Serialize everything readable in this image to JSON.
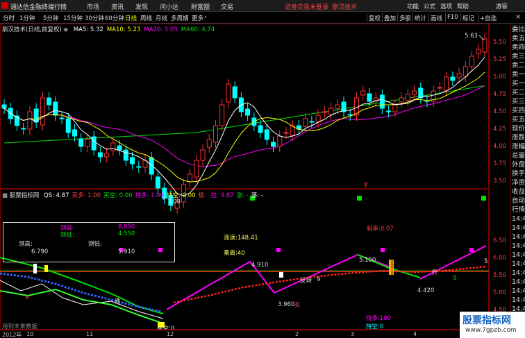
{
  "app": {
    "title": "通达信金融终端",
    "menus": [
      "行情",
      "市场",
      "资讯",
      "发现",
      "问小达",
      "财富圈",
      "交易"
    ],
    "notice": "证劵交易未登录",
    "stock_name_top": "鼎汉技术",
    "right_menus": [
      "功能",
      "公式",
      "选项",
      "帮助",
      "游客"
    ]
  },
  "toolbar": {
    "periods": [
      "分时",
      "1分钟",
      "5分钟",
      "15分钟",
      "30分钟",
      "60分钟",
      "日线",
      "周线",
      "月线",
      "多周期",
      "更多"
    ],
    "active_period": "日线",
    "more_arrow": "›",
    "buttons": [
      "复权",
      "叠加",
      "多股",
      "统计",
      "画线",
      "F10",
      "标记",
      "+自选"
    ],
    "close_icon": "×"
  },
  "main_pane": {
    "title": "鼎汉技术(日线,前复权)",
    "ma": [
      {
        "label": "MA5:",
        "value": "5.32",
        "color": "#ffffff"
      },
      {
        "label": "MA10:",
        "value": "5.23",
        "color": "#ffff00"
      },
      {
        "label": "MA20:",
        "value": "5.05",
        "color": "#ff00ff"
      },
      {
        "label": "MA60:",
        "value": "4.74",
        "color": "#00e000"
      }
    ],
    "high_label": "5.63",
    "low_label": "3.09",
    "price_ticks": [
      "5.50",
      "5.25",
      "5.00",
      "4.75",
      "4.50",
      "4.25",
      "4.00",
      "3.75",
      "3.50"
    ],
    "marker": "8"
  },
  "sub_pane": {
    "title": "股票指标网",
    "fields": [
      {
        "label": "QS:",
        "value": "4.87",
        "color": "#ffffff"
      },
      {
        "label": "买多:",
        "value": "1.00",
        "color": "#ff4040"
      },
      {
        "label": "买空:",
        "value": "0.00",
        "color": "#00e000"
      },
      {
        "label": "持多:",
        "value": "1.00",
        "color": "#ff00ff"
      },
      {
        "label": "持空:",
        "value": "0.00",
        "color": "#ffff00"
      },
      {
        "label": "极:",
        "value": "",
        "color": "#ff4040"
      },
      {
        "label": "拉:",
        "value": "4.87",
        "color": "#ff00ff"
      },
      {
        "label": "涨:",
        "value": "-",
        "color": "#00e000"
      },
      {
        "label": "落:",
        "value": "-",
        "color": "#ffffff"
      }
    ],
    "infobox": {
      "r1_label": "测高:",
      "r1_value": "8.050",
      "r2_label": "测低:",
      "r2_value": "4.550",
      "r3a_label": "测高:",
      "r3a_value": "6.790",
      "r3b_label": "测低:",
      "r3b_value": "5.910"
    },
    "annotations": {
      "speed": "涨速:148.41",
      "distance": "乘离:40",
      "slope": "斜率:0.07",
      "p1": "4.910",
      "p2": "5.100",
      "p3": "3.960",
      "p4": "4.420",
      "reverse": "反转",
      "buy": "买",
      "rise": "升",
      "fall": "跌",
      "nine_a": "9",
      "nine_b": "9",
      "nine_c": "9",
      "buy_empty": "买空:0",
      "hold_long": "持多:100",
      "hold_empty": "持空:0",
      "future_data": "用到未来数据",
      "five": "5"
    },
    "value_ticks": [
      "6.50",
      "6.00",
      "5.50",
      "5.00",
      "4.50",
      "4.00",
      "3.50"
    ]
  },
  "x_axis": {
    "labels": [
      "2012年",
      "10",
      "11",
      "12",
      "2",
      "3",
      "4"
    ]
  },
  "right_panel": {
    "items": [
      "委比",
      "卖五",
      "卖四",
      "卖三",
      "卖二",
      "卖一",
      "买一",
      "买二",
      "买三",
      "买四",
      "买五",
      "现价",
      "涨跌",
      "涨幅",
      "总量",
      "外盘",
      "换手",
      "净资",
      "收益",
      "自动",
      "行情",
      "14:4",
      "14:4",
      "14:4",
      "14:4",
      "14:4",
      "14:4",
      "14:4",
      "14:4",
      "14:4",
      "14:4",
      "14:4",
      "14:4",
      "14:4",
      "14:4"
    ]
  },
  "watermark": {
    "title": "股票指标网",
    "url": "www.7gpzb.com"
  },
  "colors": {
    "up": "#ff3030",
    "down": "#00ffff",
    "ma5": "#ffffff",
    "ma10": "#ffff00",
    "ma20": "#ff00ff",
    "ma60": "#00e000"
  }
}
